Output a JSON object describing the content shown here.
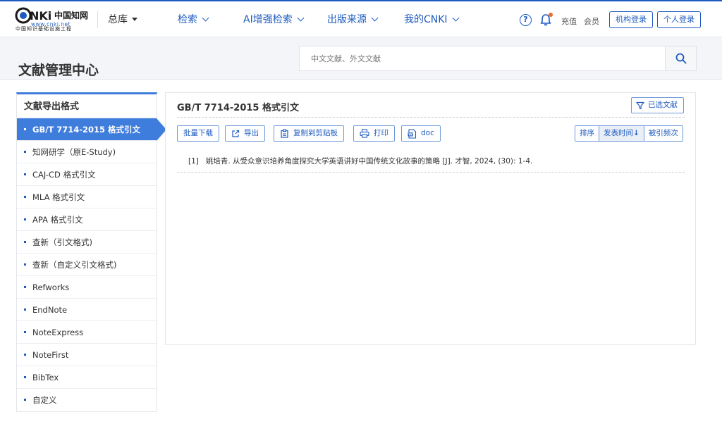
{
  "header": {
    "logo_text": "CNKi中国知网",
    "logo_url_text": "www.cnki.net",
    "logo_subtitle": "中国知识基础设施工程",
    "zongku": "总库",
    "nav": [
      "检索",
      "AI增强检索",
      "出版来源",
      "我的CNKI"
    ],
    "recharge": "充值",
    "member": "会员",
    "org_login": "机构登录",
    "personal_login": "个人登录",
    "help_glyph": "?"
  },
  "banner": {
    "title": "文献管理中心",
    "search_placeholder": "中文文献、外文文献"
  },
  "sidebar": {
    "title": "文献导出格式",
    "items": [
      "GB/T 7714-2015 格式引文",
      "知网研学（原E-Study)",
      "CAJ-CD 格式引文",
      "MLA 格式引文",
      "APA 格式引文",
      "查新（引文格式)",
      "查新（自定义引文格式)",
      "Refworks",
      "EndNote",
      "NoteExpress",
      "NoteFirst",
      "BibTex",
      "自定义"
    ],
    "active_index": 0
  },
  "main": {
    "title": "GB/T 7714-2015 格式引文",
    "selected_docs": "已选文献",
    "toolbar": {
      "batch_download": "批量下载",
      "export": "导出",
      "copy": "复制到剪贴板",
      "print": "打印",
      "doc": "doc"
    },
    "sort": {
      "label": "排序",
      "pub_time": "发表时间",
      "cited": "被引频次"
    },
    "citations": [
      {
        "num": "[1]",
        "text": "姚培青. 从受众意识培养角度探究大学英语讲好中国传统文化故事的策略 [J]. 才智, 2024, (30): 1-4."
      }
    ]
  },
  "colors": {
    "brand_blue": "#1e5bbf",
    "active_blue": "#3f7ddc",
    "notify_orange": "#f06a28"
  }
}
